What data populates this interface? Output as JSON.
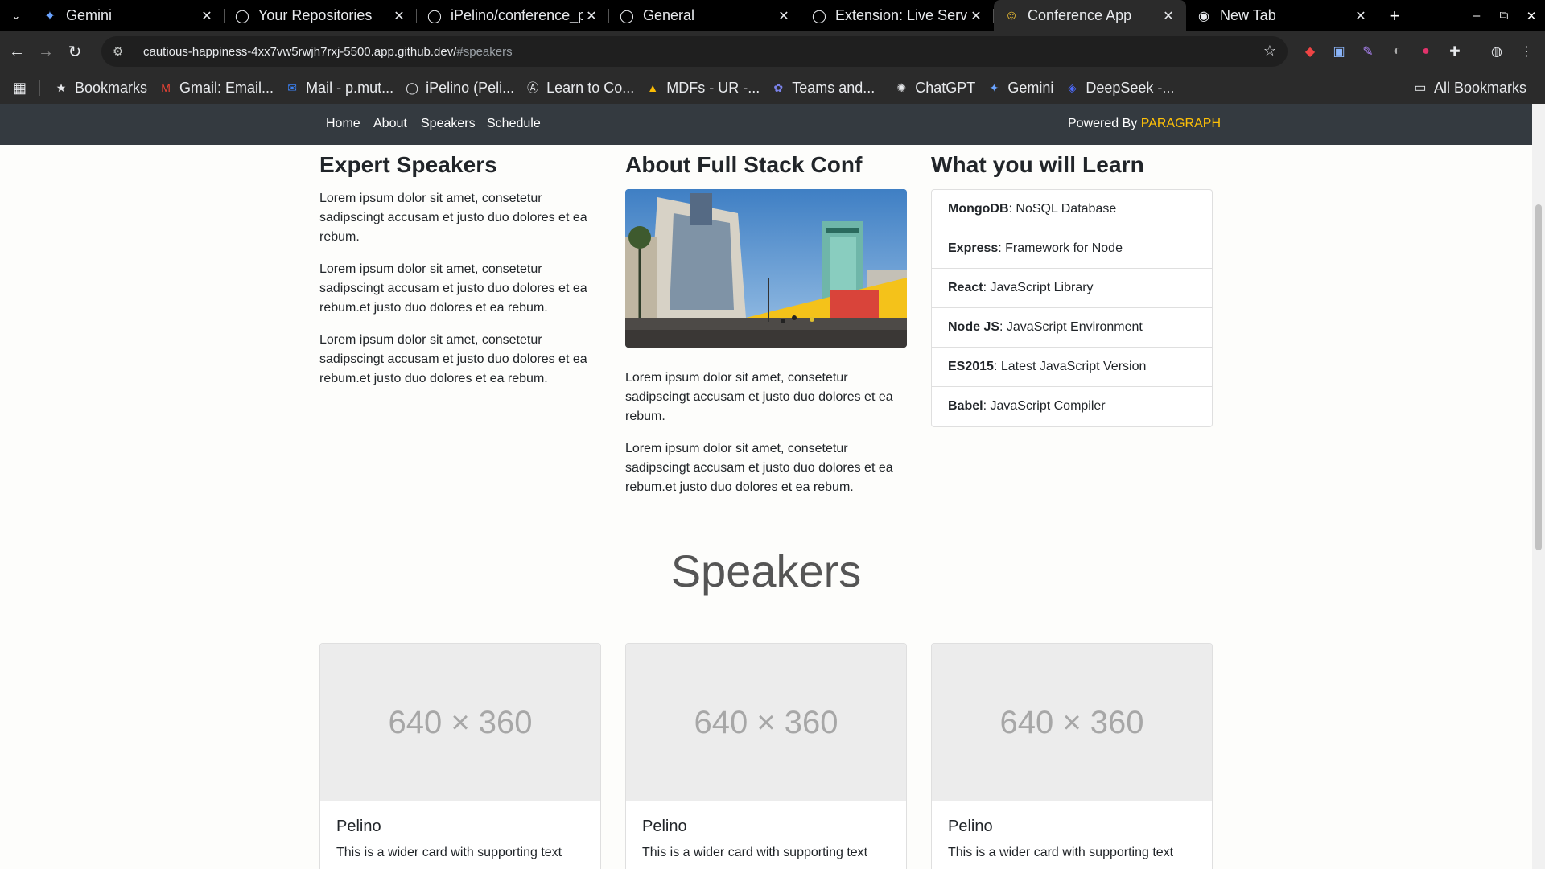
{
  "browser": {
    "tabs": [
      {
        "title": "Gemini",
        "icon": "gemini-icon",
        "active": false
      },
      {
        "title": "Your Repositories",
        "icon": "github-icon",
        "active": false
      },
      {
        "title": "iPelino/conference_p",
        "icon": "github-icon",
        "active": false
      },
      {
        "title": "General",
        "icon": "github-icon",
        "active": false
      },
      {
        "title": "Extension: Live Serv",
        "icon": "github-icon",
        "active": false
      },
      {
        "title": "Conference App",
        "icon": "emoji-icon",
        "active": true
      },
      {
        "title": "New Tab",
        "icon": "chrome-icon",
        "active": false
      }
    ],
    "url_host": "cautious-happiness-4xx7vw5rwjh7rxj-5500.app.github.dev/",
    "url_hash": "#speakers",
    "bookmarks": [
      {
        "label": "Bookmarks",
        "icon": "star-icon"
      },
      {
        "label": "Gmail: Email...",
        "icon": "gmail-icon"
      },
      {
        "label": "Mail - p.mut...",
        "icon": "outlook-icon"
      },
      {
        "label": "iPelino (Peli...",
        "icon": "github-icon"
      },
      {
        "label": "Learn to Co...",
        "icon": "codecademy-icon"
      },
      {
        "label": "MDFs - UR -...",
        "icon": "drive-icon"
      },
      {
        "label": "Teams and...",
        "icon": "teams-icon"
      },
      {
        "label": "ChatGPT",
        "icon": "chatgpt-icon"
      },
      {
        "label": "Gemini",
        "icon": "gemini-icon"
      },
      {
        "label": "DeepSeek -...",
        "icon": "deepseek-icon"
      }
    ],
    "all_bookmarks": "All Bookmarks"
  },
  "site": {
    "nav": {
      "links": [
        "Home",
        "About",
        "Speakers",
        "Schedule"
      ],
      "powered_prefix": "Powered By",
      "powered_brand": "PARAGRAPH"
    },
    "expert": {
      "title": "Expert Speakers",
      "paragraphs": [
        "Lorem ipsum dolor sit amet, consetetur sadipscingt accusam et justo duo dolores et ea rebum.",
        "Lorem ipsum dolor sit amet, consetetur sadipscingt accusam et justo duo dolores et ea rebum.et justo duo dolores et ea rebum.",
        "Lorem ipsum dolor sit amet, consetetur sadipscingt accusam et justo duo dolores et ea rebum.et justo duo dolores et ea rebum."
      ]
    },
    "about": {
      "title": "About Full Stack Conf",
      "paragraphs": [
        "Lorem ipsum dolor sit amet, consetetur sadipscingt accusam et justo duo dolores et ea rebum.",
        "Lorem ipsum dolor sit amet, consetetur sadipscingt accusam et justo duo dolores et ea rebum.et justo duo dolores et ea rebum."
      ]
    },
    "learn": {
      "title": "What you will Learn",
      "items": [
        {
          "name": "MongoDB",
          "desc": ": NoSQL Database"
        },
        {
          "name": "Express",
          "desc": ": Framework for Node"
        },
        {
          "name": "React",
          "desc": ": JavaScript Library"
        },
        {
          "name": "Node JS",
          "desc": ": JavaScript Environment"
        },
        {
          "name": "ES2015",
          "desc": ": Latest JavaScript Version"
        },
        {
          "name": "Babel",
          "desc": ": JavaScript Compiler"
        }
      ]
    },
    "speakers": {
      "title": "Speakers",
      "cards": [
        {
          "placeholder": "640 × 360",
          "name": "Pelino",
          "text": "This is a wider card with supporting text"
        },
        {
          "placeholder": "640 × 360",
          "name": "Pelino",
          "text": "This is a wider card with supporting text"
        },
        {
          "placeholder": "640 × 360",
          "name": "Pelino",
          "text": "This is a wider card with supporting text"
        }
      ]
    },
    "colors": {
      "navbar": "#343a40",
      "brand": "#ffc107",
      "placeholder_bg": "#ececec"
    }
  }
}
